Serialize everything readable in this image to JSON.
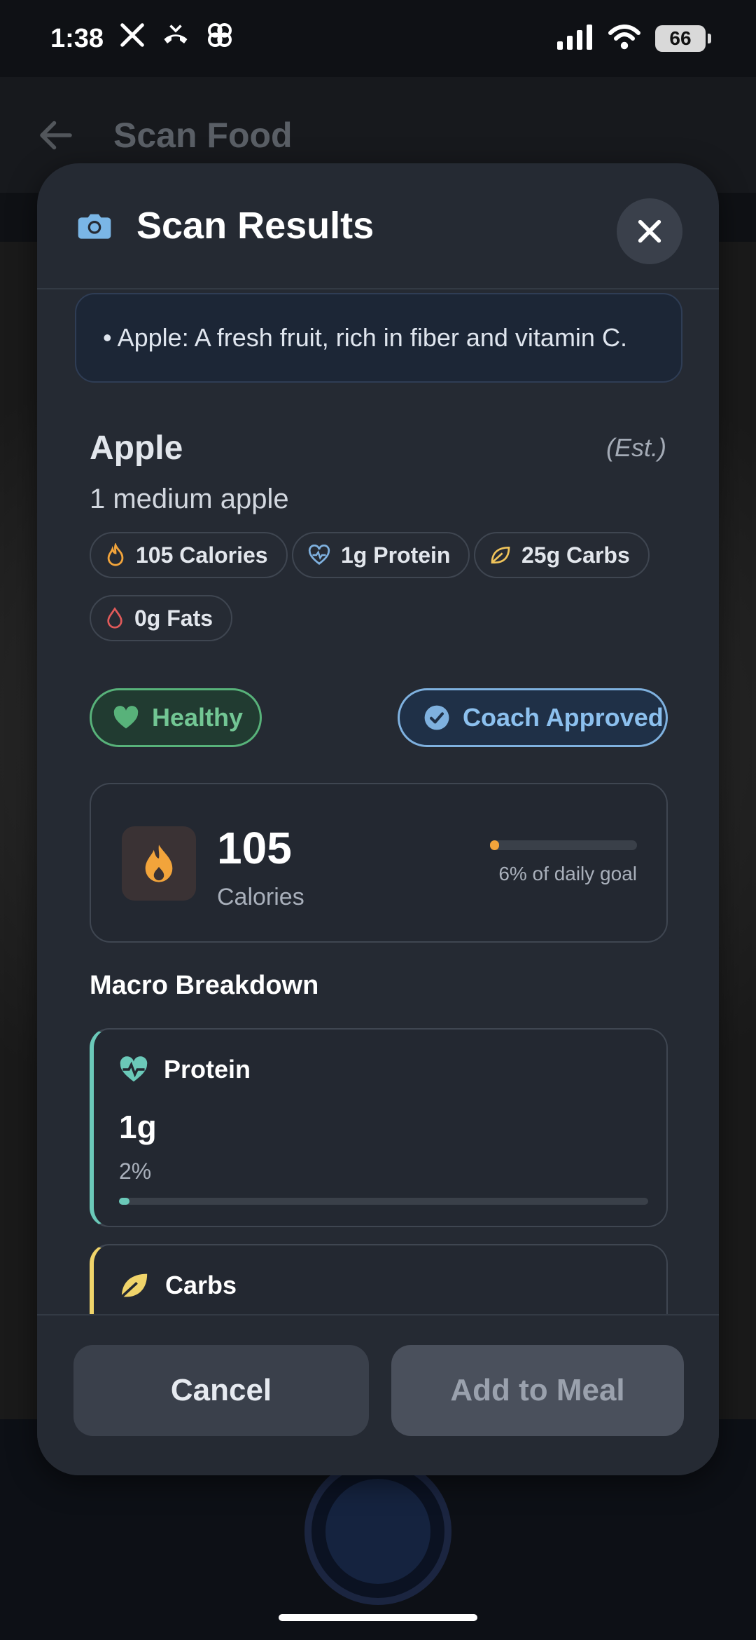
{
  "status_bar": {
    "time": "1:38",
    "battery": "66",
    "icons": [
      "x-icon",
      "missed-call-icon",
      "pinwheel-icon",
      "signal-icon",
      "wifi-icon",
      "battery-icon"
    ]
  },
  "background": {
    "title": "Scan Food"
  },
  "modal": {
    "title": "Scan Results",
    "description": "• Apple: A fresh fruit, rich in fiber and vitamin C.",
    "food": {
      "name": "Apple",
      "estimate_tag": "(Est.)",
      "serving": "1 medium apple"
    },
    "chips": {
      "calories": "105 Calories",
      "protein": "1g Protein",
      "carbs": "25g Carbs",
      "fats": "0g Fats"
    },
    "badges": {
      "healthy": "Healthy",
      "coach": "Coach Approved"
    },
    "calorie_card": {
      "value": "105",
      "label": "Calories",
      "goal_text": "6% of daily goal",
      "goal_fraction": 0.06
    },
    "macro_section_title": "Macro Breakdown",
    "macros": {
      "protein": {
        "label": "Protein",
        "amount": "1g",
        "percent_text": "2%",
        "fraction": 0.02
      },
      "carbs": {
        "label": "Carbs"
      }
    },
    "buttons": {
      "cancel": "Cancel",
      "add": "Add to Meal"
    }
  },
  "colors": {
    "accent_blue": "#7fb1df",
    "healthy_green": "#58b27a",
    "calorie_orange": "#f2a43b",
    "protein_teal": "#6bc9b9",
    "carbs_yellow": "#f0d46a"
  }
}
